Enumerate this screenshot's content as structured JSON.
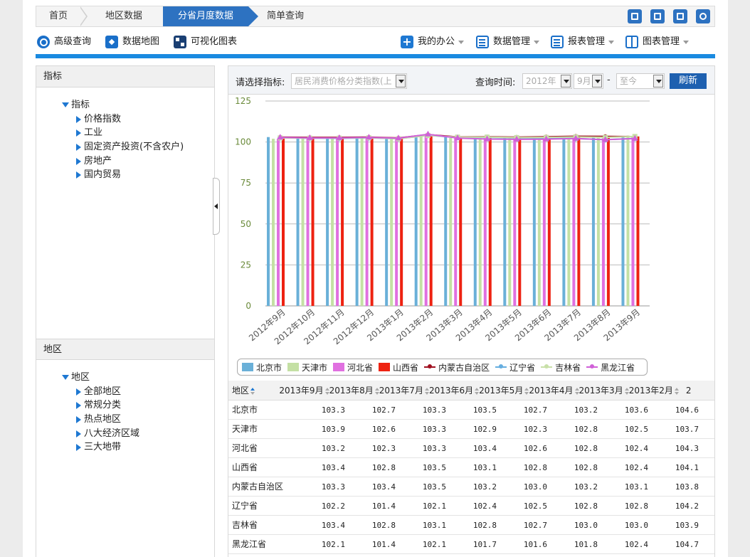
{
  "nav": {
    "home": "首页",
    "area_data": "地区数据",
    "province_monthly": "分省月度数据",
    "simple_query": "简单查询"
  },
  "top_icons": [
    "download-icon",
    "export-icon",
    "print-icon",
    "share-icon"
  ],
  "tools": {
    "advanced_query": "高级查询",
    "data_map": "数据地图",
    "visual_chart": "可视化图表",
    "my_office": "我的办公",
    "data_mgmt": "数据管理",
    "report_mgmt": "报表管理",
    "chart_mgmt": "图表管理"
  },
  "indicator_panel": {
    "title": "指标",
    "root": "指标",
    "items": [
      "价格指数",
      "工业",
      "固定资产投资(不含农户)",
      "房地产",
      "国内贸易"
    ]
  },
  "region_panel": {
    "title": "地区",
    "root": "地区",
    "items": [
      "全部地区",
      "常规分类",
      "热点地区",
      "八大经济区域",
      "三大地带"
    ]
  },
  "query": {
    "indicator_label": "请选择指标:",
    "indicator_value": "居民消费价格分类指数(上",
    "time_label": "查询时间:",
    "year": "2012年",
    "month": "9月",
    "dash": "-",
    "to": "至今",
    "refresh": "刷新"
  },
  "colors": {
    "北京市": "#6ab0d8",
    "天津市": "#c4e0a4",
    "河北省": "#e070e0",
    "山西省": "#ee2211",
    "内蒙古自治区": "#a01020",
    "辽宁省": "#66aee0",
    "吉林省": "#c8e0a8",
    "黑龙江省": "#d060d8"
  },
  "chart_data": {
    "type": "bar",
    "categories": [
      "2012年9月",
      "2012年10月",
      "2012年11月",
      "2012年12月",
      "2013年1月",
      "2013年2月",
      "2013年3月",
      "2013年4月",
      "2013年5月",
      "2013年6月",
      "2013年7月",
      "2013年8月",
      "2013年9月"
    ],
    "ylim": [
      0,
      125
    ],
    "yticks": [
      0,
      25,
      50,
      75,
      100,
      125
    ],
    "bar_series": [
      {
        "name": "北京市",
        "values": [
          103,
          102,
          102,
          102,
          102,
          104,
          103.6,
          103.2,
          102.7,
          103.5,
          103.3,
          102.7,
          103.3
        ]
      },
      {
        "name": "天津市",
        "values": [
          102,
          102,
          102,
          102,
          102,
          103.5,
          102.5,
          102.8,
          102.3,
          102.9,
          103.3,
          102.6,
          103.9
        ]
      },
      {
        "name": "河北省",
        "values": [
          102,
          102,
          102,
          102,
          102,
          104,
          102.4,
          102.8,
          102.6,
          103.4,
          103.3,
          102.3,
          103.2
        ]
      },
      {
        "name": "山西省",
        "values": [
          102,
          102,
          102,
          102,
          102,
          103.8,
          102.4,
          102.8,
          102.8,
          103.1,
          103.5,
          102.8,
          103.4
        ]
      }
    ],
    "line_series": [
      {
        "name": "内蒙古自治区",
        "marker": "circle",
        "values": [
          103,
          102.8,
          102.8,
          103,
          102.5,
          104.5,
          103.1,
          103.2,
          103,
          103.2,
          103.5,
          103.4,
          103.3
        ]
      },
      {
        "name": "辽宁省",
        "marker": "diamond",
        "values": [
          102.5,
          102.3,
          102.2,
          102.5,
          102,
          104,
          102.8,
          102.8,
          102.5,
          102.4,
          102.1,
          101.4,
          102.2
        ]
      },
      {
        "name": "吉林省",
        "marker": "square",
        "values": [
          102.5,
          102.4,
          102.4,
          102.6,
          102,
          104,
          103,
          103,
          102.7,
          102.8,
          103.1,
          102.8,
          103.4
        ]
      },
      {
        "name": "黑龙江省",
        "marker": "triangle",
        "values": [
          102.8,
          102.5,
          102.5,
          102.8,
          102.3,
          104.7,
          102.4,
          101.8,
          101.6,
          101.7,
          102.1,
          101.4,
          102.1
        ]
      }
    ],
    "legend": [
      "北京市",
      "天津市",
      "河北省",
      "山西省",
      "内蒙古自治区",
      "辽宁省",
      "吉林省",
      "黑龙江省"
    ],
    "legend_position": "bottom"
  },
  "table": {
    "region_header": "地区",
    "columns": [
      "2013年9月",
      "2013年8月",
      "2013年7月",
      "2013年6月",
      "2013年5月",
      "2013年4月",
      "2013年3月",
      "2013年2月",
      "2"
    ],
    "rows": [
      {
        "region": "北京市",
        "values": [
          "103.3",
          "102.7",
          "103.3",
          "103.5",
          "102.7",
          "103.2",
          "103.6",
          "104.6"
        ]
      },
      {
        "region": "天津市",
        "values": [
          "103.9",
          "102.6",
          "103.3",
          "102.9",
          "102.3",
          "102.8",
          "102.5",
          "103.7"
        ]
      },
      {
        "region": "河北省",
        "values": [
          "103.2",
          "102.3",
          "103.3",
          "103.4",
          "102.6",
          "102.8",
          "102.4",
          "104.3"
        ]
      },
      {
        "region": "山西省",
        "values": [
          "103.4",
          "102.8",
          "103.5",
          "103.1",
          "102.8",
          "102.8",
          "102.4",
          "104.1"
        ]
      },
      {
        "region": "内蒙古自治区",
        "values": [
          "103.3",
          "103.4",
          "103.5",
          "103.2",
          "103.0",
          "103.2",
          "103.1",
          "103.8"
        ]
      },
      {
        "region": "辽宁省",
        "values": [
          "102.2",
          "101.4",
          "102.1",
          "102.4",
          "102.5",
          "102.8",
          "102.8",
          "104.2"
        ]
      },
      {
        "region": "吉林省",
        "values": [
          "103.4",
          "102.8",
          "103.1",
          "102.8",
          "102.7",
          "103.0",
          "103.0",
          "103.9"
        ]
      },
      {
        "region": "黑龙江省",
        "values": [
          "102.1",
          "101.4",
          "102.1",
          "101.7",
          "101.6",
          "101.8",
          "102.4",
          "104.7"
        ]
      }
    ]
  }
}
